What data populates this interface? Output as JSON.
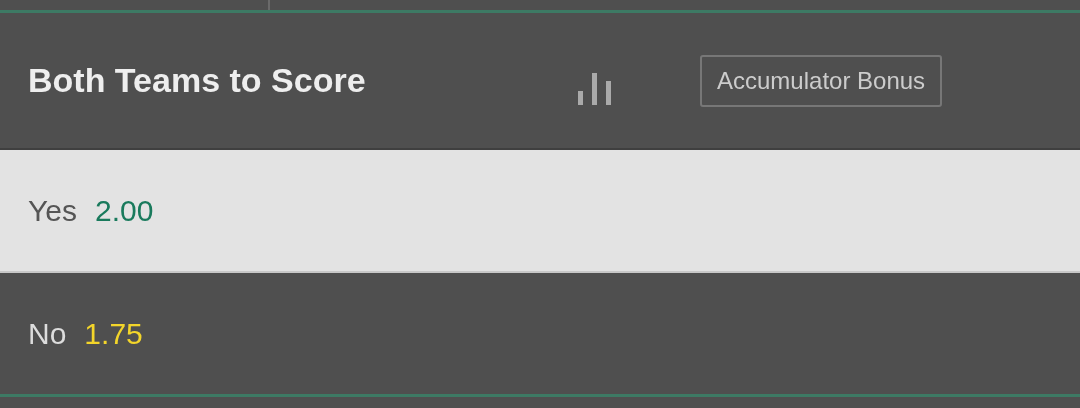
{
  "market": {
    "title": "Both Teams to Score",
    "badge": "Accumulator Bonus"
  },
  "selections": [
    {
      "label": "Yes",
      "odds": "2.00",
      "selected": false
    },
    {
      "label": "No",
      "odds": "1.75",
      "selected": true
    }
  ]
}
